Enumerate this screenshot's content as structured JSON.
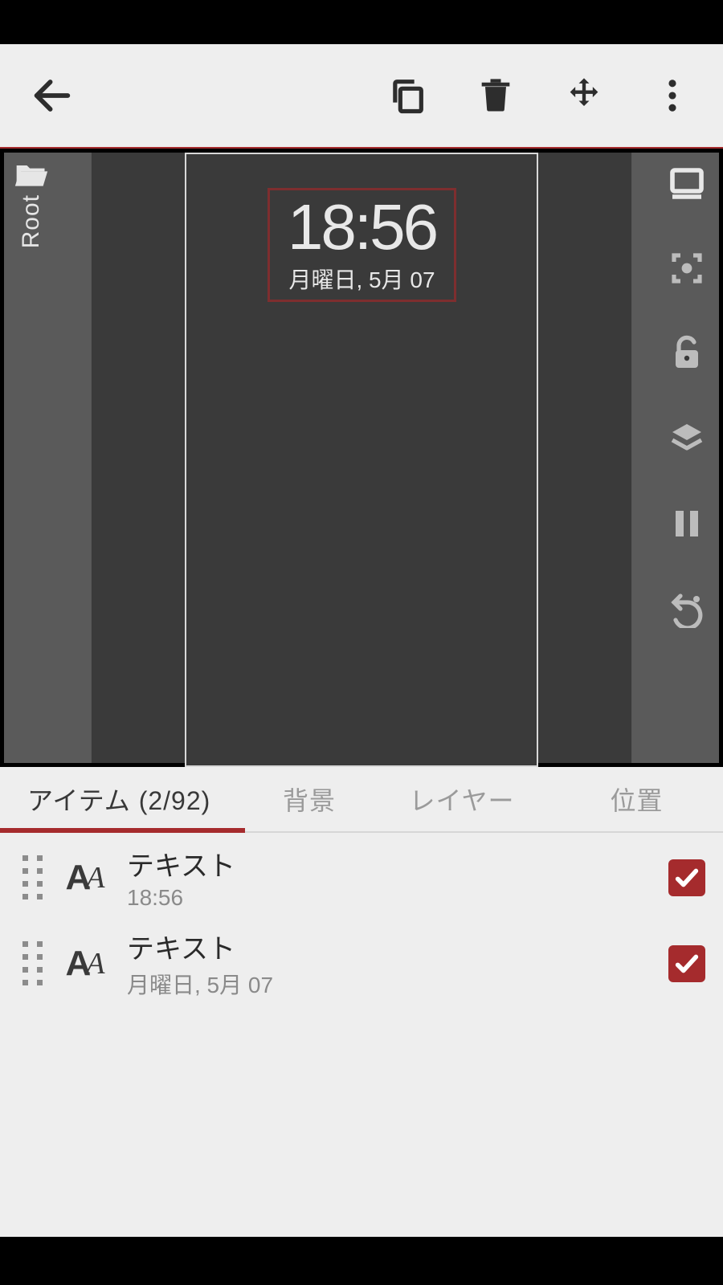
{
  "breadcrumb": {
    "label": "Root"
  },
  "preview": {
    "time": "18:56",
    "date": "月曜日, 5月 07"
  },
  "tabs": {
    "items_label": "アイテム (2/92)",
    "background_label": "背景",
    "layer_label": "レイヤー",
    "position_label": "位置"
  },
  "list": [
    {
      "title": "テキスト",
      "subtitle": "18:56"
    },
    {
      "title": "テキスト",
      "subtitle": "月曜日, 5月 07"
    }
  ]
}
